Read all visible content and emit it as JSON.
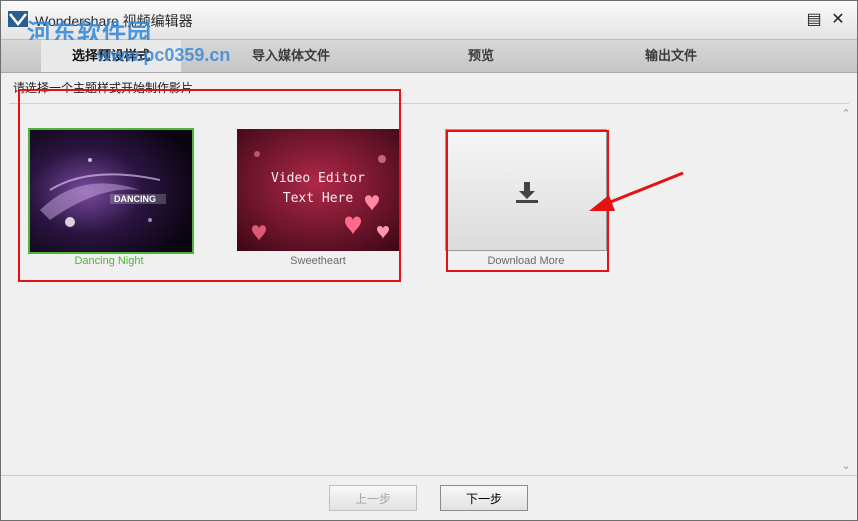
{
  "window": {
    "title": "Wondershare 视频编辑器",
    "watermark_logo": "河东软件园",
    "watermark_url": "www.pc0359.cn"
  },
  "steps": [
    {
      "label": "选择预设样式",
      "active": true
    },
    {
      "label": "导入媒体文件",
      "active": false
    },
    {
      "label": "预览",
      "active": false
    },
    {
      "label": "输出文件",
      "active": false
    }
  ],
  "instruction": "请选择一个主题样式开始制作影片",
  "themes": [
    {
      "name": "Dancing Night",
      "selected": true,
      "overlay_text": "DANCING"
    },
    {
      "name": "Sweetheart",
      "selected": false,
      "overlay_text": "Video Editor Text Here"
    }
  ],
  "download_more": {
    "label": "Download More",
    "icon": "download-icon"
  },
  "buttons": {
    "prev": "上一步",
    "next": "下一步"
  },
  "colors": {
    "selected_border": "#4fb43a",
    "annotation_red": "#e41212"
  }
}
